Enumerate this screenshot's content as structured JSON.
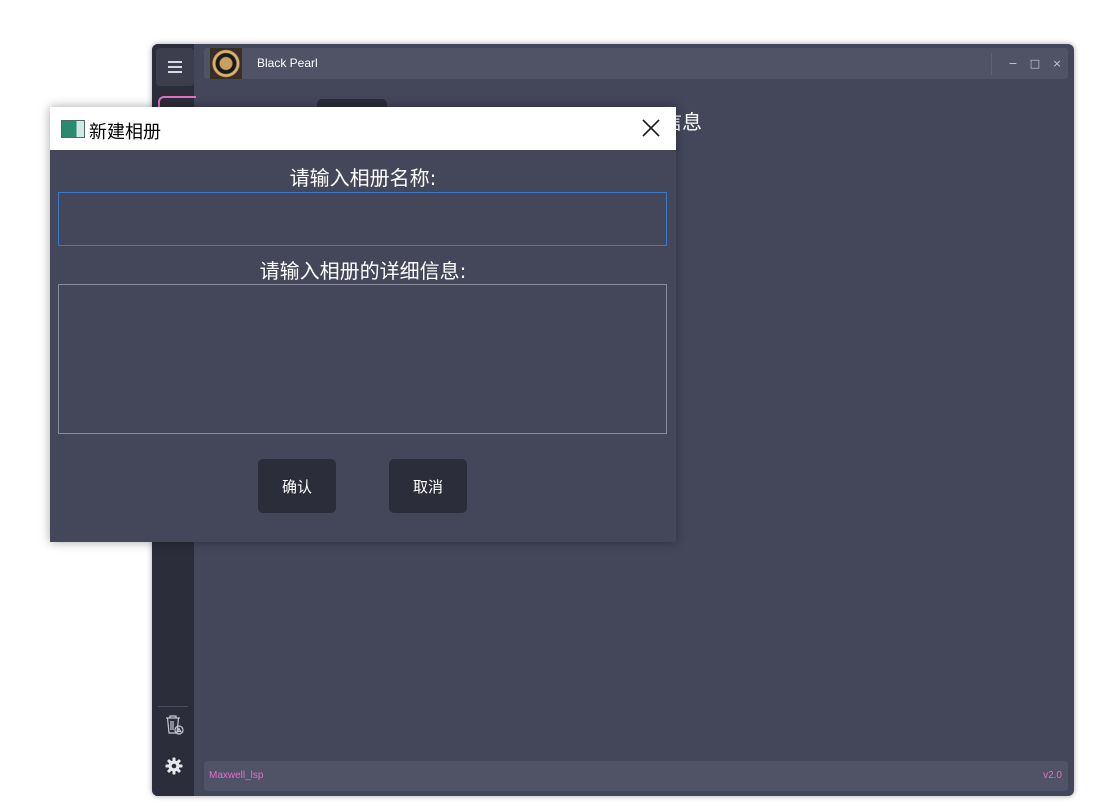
{
  "app": {
    "title": "Black Pearl",
    "background_heading": "详细信息",
    "footer_left": "Maxwell_lsp",
    "footer_right": "v2.0",
    "window_controls": {
      "minimize": "−",
      "maximize": "□",
      "close": "×"
    },
    "colors": {
      "accent": "#e070c8",
      "window_bg": "#44465a",
      "sidebar_bg": "#2c2d3a",
      "bar_bg": "#505266"
    }
  },
  "sidebar": {
    "items": [
      {
        "icon": "hamburger-menu-icon"
      },
      {
        "icon": "photo-icon"
      },
      {
        "icon": "trash-icon"
      },
      {
        "icon": "gear-icon"
      }
    ]
  },
  "dialog": {
    "title": "新建相册",
    "name_label": "请输入相册名称:",
    "name_value": "",
    "detail_label": "请输入相册的详细信息:",
    "detail_value": "",
    "confirm_label": "确认",
    "cancel_label": "取消",
    "close_icon": "close-icon",
    "colors": {
      "input_focus_border": "#3a78c8",
      "button_bg": "#2c2d3a"
    }
  }
}
